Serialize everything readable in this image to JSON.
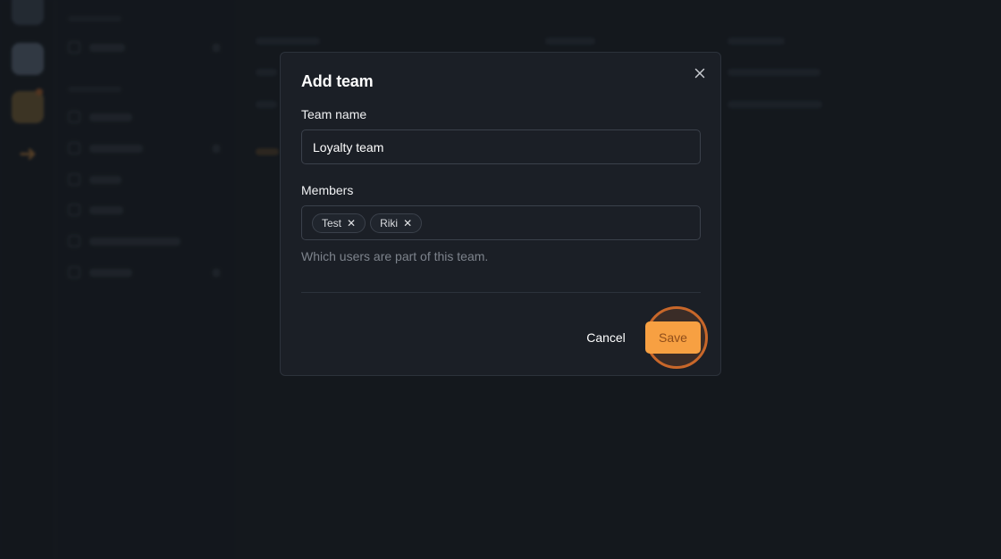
{
  "modal": {
    "title": "Add team",
    "team_name_label": "Team name",
    "team_name_value": "Loyalty team",
    "members_label": "Members",
    "members": [
      {
        "name": "Test"
      },
      {
        "name": "Riki"
      }
    ],
    "members_hint": "Which users are part of this team.",
    "cancel_label": "Cancel",
    "save_label": "Save",
    "tag_remove_glyph": "✕",
    "close_icon": "close-icon"
  },
  "colors": {
    "background": "#181c22",
    "modal": "#1b1f26",
    "accent": "#f7a042",
    "highlight_ring": "#c8672a"
  }
}
